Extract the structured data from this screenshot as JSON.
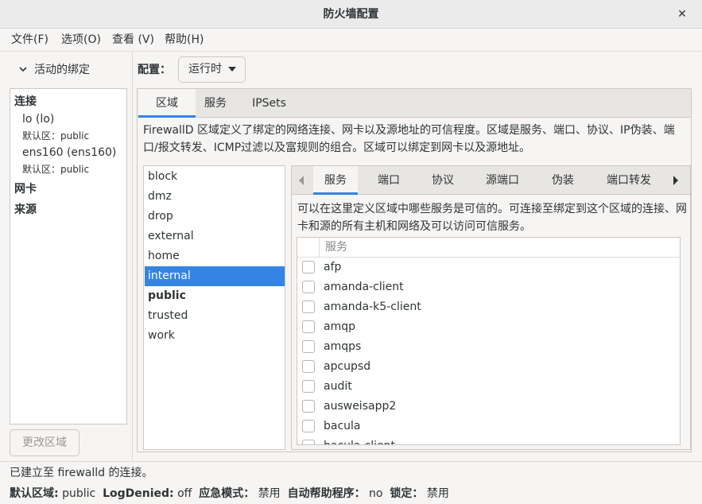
{
  "window": {
    "title": "防火墙配置",
    "close_symbol": "✕"
  },
  "menu": [
    "文件(F)",
    "选项(O)",
    "查看 (V)",
    "帮助(H)"
  ],
  "left_panel": {
    "header": "活动的绑定",
    "sections": {
      "connections": "连接",
      "conn1_name": "lo (lo)",
      "conn1_zone": "默认区：public",
      "conn2_name": "ens160 (ens160)",
      "conn2_zone": "默认区：public",
      "interfaces": "网卡",
      "sources": "来源"
    },
    "change_zone_button": "更改区域"
  },
  "config": {
    "label": "配置：",
    "value": "运行时"
  },
  "main_tabs": [
    "区域",
    "服务",
    "IPSets"
  ],
  "zone_description": "FirewallD 区域定义了绑定的网络连接、网卡以及源地址的可信程度。区域是服务、端口、协议、IP伪装、端口/报文转发、ICMP过滤以及富规则的组合。区域可以绑定到网卡以及源地址。",
  "zones": [
    "block",
    "dmz",
    "drop",
    "external",
    "home",
    "internal",
    "public",
    "trusted",
    "work"
  ],
  "selected_zone": "internal",
  "default_zone_bold": "public",
  "zone_tabs": [
    "服务",
    "端口",
    "协议",
    "源端口",
    "伪装",
    "端口转发"
  ],
  "service_description": "可以在这里定义区域中哪些服务是可信的。可连接至绑定到这个区域的连接、网卡和源的所有主机和网络及可以访问可信服务。",
  "service_column": "服务",
  "services": [
    "afp",
    "amanda-client",
    "amanda-k5-client",
    "amqp",
    "amqps",
    "apcupsd",
    "audit",
    "ausweisapp2",
    "bacula",
    "bacula-client"
  ],
  "status": {
    "line1": "已建立至 firewalld 的连接。",
    "default_zone_label": "默认区域:",
    "default_zone_value": "public",
    "logdenied_label": "LogDenied:",
    "logdenied_value": "off",
    "panic_label": "应急模式：",
    "panic_value": "禁用",
    "auto_helper_label": "自动帮助程序：",
    "auto_helper_value": "no",
    "lockdown_label": "锁定：",
    "lockdown_value": "禁用"
  },
  "colors": {
    "accent": "#3584e4",
    "selection_text": "#ffffff",
    "border": "#cdc7c2"
  }
}
